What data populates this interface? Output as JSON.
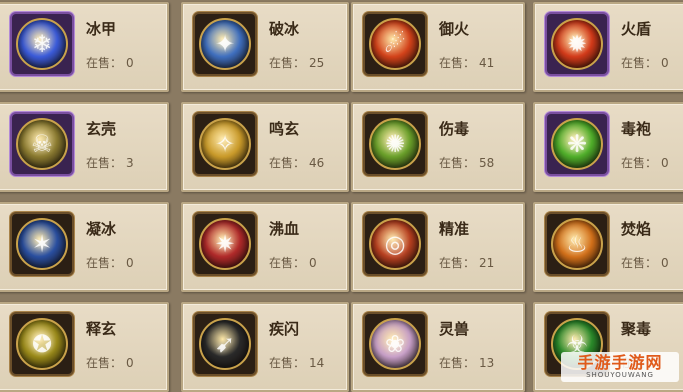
{
  "stock_label": "在售：",
  "skills": [
    {
      "name": "冰甲",
      "count": "0",
      "icon": "ice-armor-icon",
      "frame": "purple",
      "color": "#3b5bd9",
      "glyph": "❄"
    },
    {
      "name": "破冰",
      "count": "25",
      "icon": "ice-break-icon",
      "frame": "gold",
      "color": "#3f6fbf",
      "glyph": "✦"
    },
    {
      "name": "御火",
      "count": "41",
      "icon": "fire-control-icon",
      "frame": "gold",
      "color": "#d2421a",
      "glyph": "☄"
    },
    {
      "name": "火盾",
      "count": "0",
      "icon": "fire-shield-icon",
      "frame": "purple",
      "color": "#d23a1a",
      "glyph": "✹"
    },
    {
      "name": "玄壳",
      "count": "3",
      "icon": "dark-shell-icon",
      "frame": "purple",
      "color": "#8a7a30",
      "glyph": "☠"
    },
    {
      "name": "鸣玄",
      "count": "46",
      "icon": "dark-bell-icon",
      "frame": "gold",
      "color": "#c99a2a",
      "glyph": "✧"
    },
    {
      "name": "伤毒",
      "count": "58",
      "icon": "poison-wound-icon",
      "frame": "gold",
      "color": "#6aa02a",
      "glyph": "✺"
    },
    {
      "name": "毒袍",
      "count": "0",
      "icon": "poison-robe-icon",
      "frame": "purple",
      "color": "#4fae2a",
      "glyph": "❋"
    },
    {
      "name": "凝冰",
      "count": "0",
      "icon": "freeze-icon",
      "frame": "gold",
      "color": "#2a4fa0",
      "glyph": "✶"
    },
    {
      "name": "沸血",
      "count": "0",
      "icon": "boiling-blood-icon",
      "frame": "gold",
      "color": "#b02a2a",
      "glyph": "✷"
    },
    {
      "name": "精准",
      "count": "21",
      "icon": "precision-icon",
      "frame": "gold",
      "color": "#b84020",
      "glyph": "◎"
    },
    {
      "name": "焚焰",
      "count": "0",
      "icon": "burning-flame-icon",
      "frame": "gold",
      "color": "#d2701a",
      "glyph": "♨"
    },
    {
      "name": "释玄",
      "count": "0",
      "icon": "release-dark-icon",
      "frame": "gold",
      "color": "#9a8a1a",
      "glyph": "✪"
    },
    {
      "name": "疾闪",
      "count": "14",
      "icon": "quick-dash-icon",
      "frame": "gold",
      "color": "#2a2a2a",
      "glyph": "➹"
    },
    {
      "name": "灵兽",
      "count": "13",
      "icon": "spirit-beast-icon",
      "frame": "gold",
      "color": "#c8a0c8",
      "glyph": "❀"
    },
    {
      "name": "聚毒",
      "count": "",
      "icon": "gather-poison-icon",
      "frame": "gold",
      "color": "#2a8a2a",
      "glyph": "☣"
    }
  ],
  "watermark": {
    "main": "手游手游网",
    "sub": "SHOUYOUWANG"
  }
}
